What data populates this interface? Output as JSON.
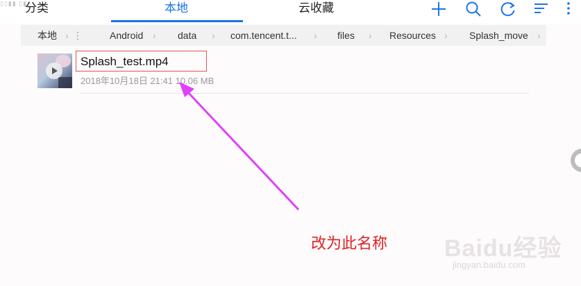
{
  "header": {
    "tabs": [
      {
        "label": "分类",
        "active": false
      },
      {
        "label": "本地",
        "active": true
      },
      {
        "label": "云收藏",
        "active": false
      }
    ],
    "icons": [
      "add-icon",
      "search-icon",
      "refresh-icon",
      "sort-icon",
      "menu-icon"
    ]
  },
  "breadcrumb": {
    "items": [
      "本地",
      "Android",
      "data",
      "com.tencent.t...",
      "files",
      "Resources",
      "Splash_move"
    ]
  },
  "file": {
    "name": "Splash_test.mp4",
    "meta": "2018年10月18日 21:41 10.06 MB"
  },
  "annotation": {
    "text": "改为此名称",
    "color": "#e02020",
    "arrow_color": "#e040fb"
  },
  "watermark": {
    "logo": "Baidu经验",
    "url": "jingyan.baidu.com"
  },
  "colors": {
    "accent": "#1a73e8",
    "highlight_box": "#e05555"
  }
}
